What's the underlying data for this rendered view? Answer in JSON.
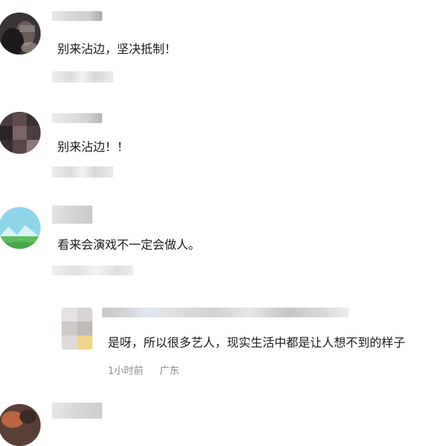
{
  "comments": [
    {
      "text": "别来沾边，坚决抵制！"
    },
    {
      "text": "别来沾边！！"
    },
    {
      "text": "看来会演戏不一定会做人。"
    }
  ],
  "reply": {
    "text": "是呀，所以很多艺人，现实生活中都是让人想不到的样子",
    "time": "1小时前",
    "location": "广东"
  }
}
